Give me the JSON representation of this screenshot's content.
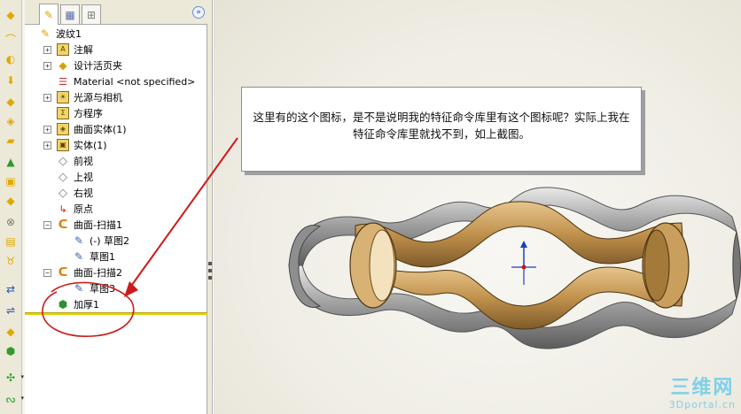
{
  "toolbar": {
    "icons": [
      "extrude-icon",
      "revolve-icon",
      "sweep-icon",
      "loft-icon",
      "fillet-icon",
      "shell-icon",
      "rib-icon",
      "draft-icon",
      "wrap-icon",
      "pattern-icon",
      "mirror-icon",
      "hole-icon",
      "dome-icon",
      "flex-icon",
      "move-face-icon",
      "curve-icon",
      "split-line-icon",
      "plane-icon",
      "reference-point-icon",
      "helix-icon"
    ]
  },
  "feature_manager": {
    "tabs": [
      "featuremanager-tab",
      "propertymanager-tab",
      "configurationmanager-tab"
    ],
    "expand_glyph": "»",
    "tree": [
      {
        "label": "波纹1",
        "icon": "part-icon",
        "expander": ""
      },
      {
        "label": "注解",
        "icon": "annotations-icon",
        "expander": "+"
      },
      {
        "label": "设计活页夹",
        "icon": "design-binder-icon",
        "expander": "+"
      },
      {
        "label": "Material <not specified>",
        "icon": "material-icon",
        "expander": ""
      },
      {
        "label": "光源与相机",
        "icon": "lights-cameras-icon",
        "expander": "+"
      },
      {
        "label": "方程序",
        "icon": "equations-icon",
        "expander": ""
      },
      {
        "label": "曲面实体(1)",
        "icon": "surface-bodies-icon",
        "expander": "+"
      },
      {
        "label": "实体(1)",
        "icon": "solid-bodies-icon",
        "expander": "+"
      },
      {
        "label": "前视",
        "icon": "plane-icon",
        "expander": ""
      },
      {
        "label": "上视",
        "icon": "plane-icon",
        "expander": ""
      },
      {
        "label": "右视",
        "icon": "plane-icon",
        "expander": ""
      },
      {
        "label": "原点",
        "icon": "origin-icon",
        "expander": ""
      },
      {
        "label": "曲面-扫描1",
        "icon": "surface-sweep-icon",
        "expander": "−"
      },
      {
        "label": "(-) 草图2",
        "icon": "sketch-icon",
        "expander": ""
      },
      {
        "label": "草图1",
        "icon": "sketch-icon",
        "expander": ""
      },
      {
        "label": "曲面-扫描2",
        "icon": "surface-sweep-icon",
        "expander": "−"
      },
      {
        "label": "草图3",
        "icon": "sketch-icon",
        "expander": ""
      },
      {
        "label": "加厚1",
        "icon": "thicken-icon",
        "expander": ""
      }
    ]
  },
  "callout": {
    "text": "这里有的这个图标，是不是说明我的特征命令库里有这个图标呢？实际上我在特征命令库里就找不到，如上截图。"
  },
  "watermark": {
    "main": "三维网",
    "sub": "3Dportal.cn"
  },
  "colors": {
    "annotation_red": "#cc1a1a",
    "rollback_bar": "#e2d200",
    "model_gold": "#c79a55",
    "model_silver": "#b9b9b9"
  }
}
